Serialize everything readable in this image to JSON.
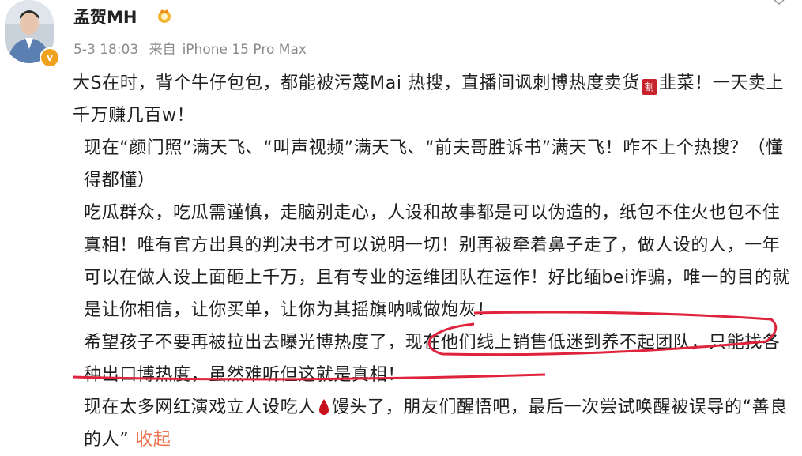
{
  "user": {
    "name": "孟贺MH",
    "avatar_icon": "avatar-photo",
    "verified_icon": "verified-v-icon",
    "badge_icon": "fan-badge-icon"
  },
  "meta": {
    "time": "5-3 18:03",
    "source_prefix": "来自",
    "device": "iPhone 15 Pro Max"
  },
  "post": {
    "p1_a": "大S在时，背个牛仔包包，都能被污蔑Mai 热搜，直播间讽刺博热度卖货",
    "p1_emoji": "割",
    "p1_b": "韭菜！一天卖上千万赚几百w！",
    "p2": "现在“颜门照”满天飞、“叫声视频”满天飞、“前夫哥胜诉书”满天飞！咋不上个热搜？（懂得都懂）",
    "p3": "吃瓜群众，吃瓜需谨慎，走脑别走心，人设和故事都是可以伪造的，纸包不住火也包不住真相！唯有官方出具的判决书才可以说明一切！别再被牵着鼻子走了，做人设的人，一年可以在做人设上面砸上千万，且有专业的运维团队在运作！好比缅bei诈骗，唯一的目的就是让你相信，让你买单，让你为其摇旗呐喊做炮灰！",
    "p4": "希望孩子不要再被拉出去曝光博热度了，现在他们线上销售低迷到养不起团队，只能找各种出口博热度，虽然难听但这就是真相！",
    "p5_a": "现在太多网红演戏立人设吃人",
    "p5_b": "馒头了，朋友们醒悟吧，最后一次尝试唤醒被误导的“善良的人”",
    "collapse": "收起"
  },
  "colors": {
    "accent_link": "#eb7350",
    "annotation_red": "#e0233c",
    "meta_gray": "#8a8a8a"
  }
}
